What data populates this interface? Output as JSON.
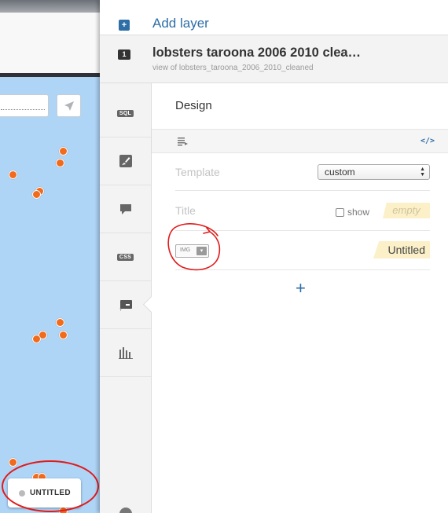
{
  "panel": {
    "add_layer": {
      "label": "Add layer",
      "icon": "plus-icon"
    },
    "layer": {
      "number": "1",
      "name": "lobsters taroona 2006 2010 clea…",
      "subtitle": "view of lobsters_taroona_2006_2010_cleaned"
    },
    "side_nav": [
      {
        "name": "sql",
        "label": "SQL"
      },
      {
        "name": "wizard",
        "icon": "brush-icon"
      },
      {
        "name": "infowindow",
        "icon": "speech-bubble-icon"
      },
      {
        "name": "css",
        "label": "CSS"
      },
      {
        "name": "legend",
        "icon": "legend-icon",
        "active": true
      },
      {
        "name": "filters",
        "icon": "bar-chart-icon"
      }
    ],
    "design": {
      "title": "Design",
      "code_toggle": "</>",
      "template_label": "Template",
      "template_value": "custom",
      "title_label": "Title",
      "show_label": "show",
      "title_value": "empty",
      "img_widget_label": "IMG",
      "item_value": "Untitled",
      "add_label": "+"
    }
  },
  "map": {
    "legend_label": "UNTITLED"
  },
  "colors": {
    "accent": "#2d6ea6",
    "marker": "#f26a1b",
    "map_water": "#aed4f6",
    "annotation": "#e11b1b",
    "tag_bg": "#fbf0c8"
  }
}
